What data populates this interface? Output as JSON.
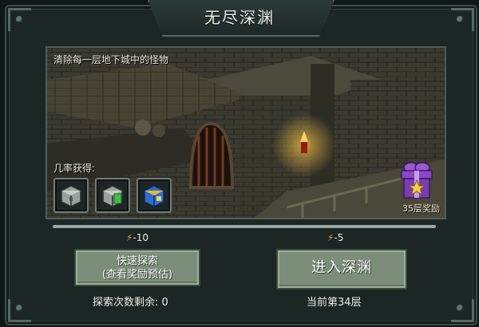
{
  "window": {
    "title": "无尽深渊"
  },
  "scene": {
    "description": "清除每一层地下城中的怪物",
    "chance_label": "几率获得:",
    "reward_label": "35层奖励",
    "items": [
      {
        "icon": "gray-chest-icon"
      },
      {
        "icon": "green-chest-icon"
      },
      {
        "icon": "blue-chest-icon"
      }
    ]
  },
  "fast_explore": {
    "cost": "-10",
    "label_line1": "快速探索",
    "label_line2": "(查看奖励预估)",
    "remaining": "探索次数剩余: 0"
  },
  "enter_abyss": {
    "cost": "-5",
    "label": "进入深渊",
    "current_floor": "当前第34层"
  },
  "colors": {
    "energy": "#f2a21e",
    "button": "#7c8e7a",
    "gift": "#7b3ab8"
  }
}
